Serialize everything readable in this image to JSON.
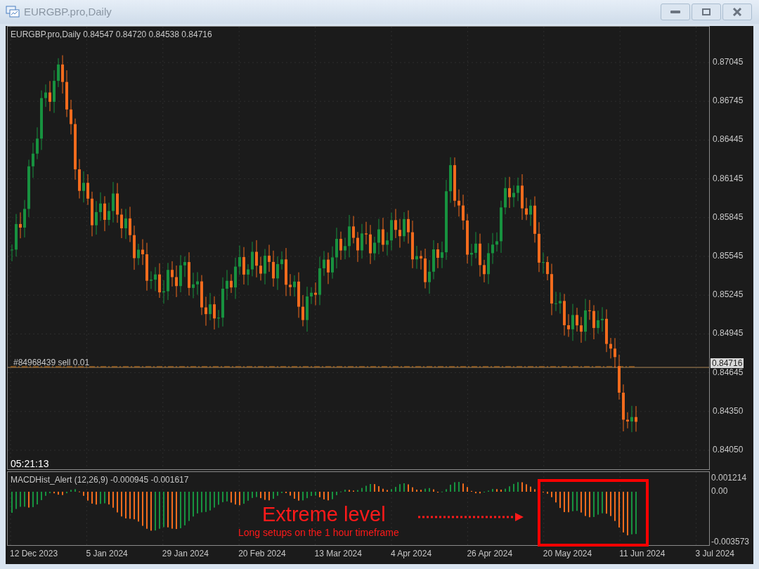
{
  "window": {
    "title": "EURGBP.pro,Daily"
  },
  "chart": {
    "header": "EURGBP.pro,Daily  0.84547 0.84720 0.84538 0.84716",
    "order_line": "#84968439 sell 0.01",
    "current_price": "0.84716",
    "timer": "05:21:13",
    "price_axis": [
      "0.87045",
      "0.86745",
      "0.86445",
      "0.86145",
      "0.85845",
      "0.85545",
      "0.85245",
      "0.84945",
      "0.84645",
      "0.84350",
      "0.84050"
    ]
  },
  "indicator": {
    "header": "MACDHist_Alert (12,26,9)  -0.000945 -0.001617",
    "axis": [
      "0.001214",
      "0.00",
      "-0.003573"
    ]
  },
  "annotation": {
    "title": "Extreme level",
    "subtitle": "Long setups on the 1 hour timeframe"
  },
  "date_axis": [
    "12 Dec 2023",
    "5 Jan 2024",
    "29 Jan 2024",
    "20 Feb 2024",
    "13 Mar 2024",
    "4 Apr 2024",
    "26 Apr 2024",
    "20 May 2024",
    "11 Jun 2024",
    "3 Jul 2024"
  ]
}
